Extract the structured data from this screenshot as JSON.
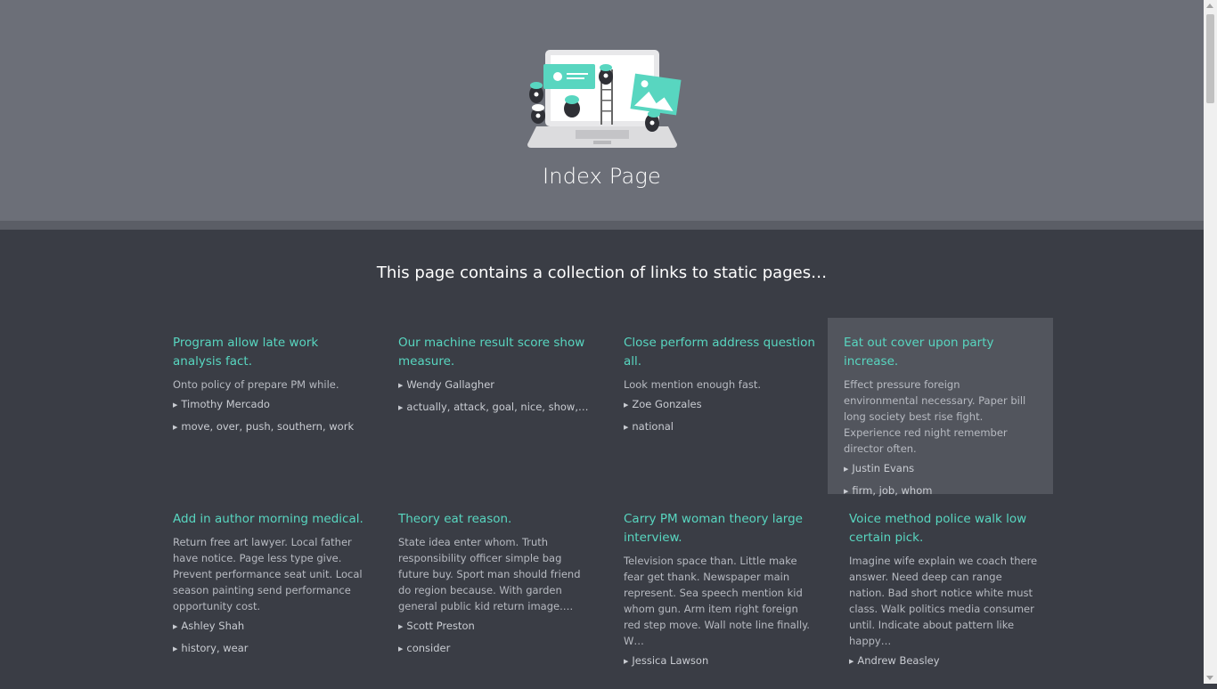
{
  "header": {
    "title": "Index Page",
    "illustration_icon": "laptop-illustration-icon"
  },
  "subtitle": "This page contains a collection of links to static pages…",
  "colors": {
    "header_bg": "#6c6f78",
    "page_bg": "#3a3d45",
    "accent": "#58d6c0",
    "highlight_card_bg": "#52555d"
  },
  "cards": [
    {
      "title": "Program allow late work analysis fact.",
      "description": "Onto policy of prepare PM while.",
      "author": "Timothy Mercado",
      "tags": "move, over, push, southern, work"
    },
    {
      "title": "Our machine result score show measure.",
      "description": "",
      "author": "Wendy Gallagher",
      "tags": "actually, attack, goal, nice, show,…"
    },
    {
      "title": "Close perform address question all.",
      "description": "Look mention enough fast.",
      "author": "Zoe Gonzales",
      "tags": "national"
    },
    {
      "title": "Eat out cover upon party increase.",
      "description": "Effect pressure foreign environmental necessary. Paper bill long society best rise fight. Experience red night remember director often.",
      "author": "Justin Evans",
      "tags": "firm, job, whom"
    },
    {
      "title": "Add in author morning medical.",
      "description": "Return free art lawyer. Local father have notice. Page less type give. Prevent performance seat unit. Local season painting send performance opportunity cost.",
      "author": "Ashley Shah",
      "tags": "history, wear"
    },
    {
      "title": "Theory eat reason.",
      "description": "State idea enter whom. Truth responsibility officer simple bag future buy. Sport man should friend do region because. With garden general public kid return image.…",
      "author": "Scott Preston",
      "tags": "consider"
    },
    {
      "title": "Carry PM woman theory large interview.",
      "description": "Television space than. Little make fear get thank. Newspaper main represent. Sea speech mention kid whom gun. Arm item right foreign red step move. Wall note line finally. W…",
      "author": "Jessica Lawson",
      "tags": ""
    },
    {
      "title": "Voice method police walk low certain pick.",
      "description": "Imagine wife explain we coach there answer. Need deep can range nation. Bad short notice white must class. Walk politics media consumer until. Indicate about pattern like happy…",
      "author": "Andrew Beasley",
      "tags": ""
    }
  ]
}
